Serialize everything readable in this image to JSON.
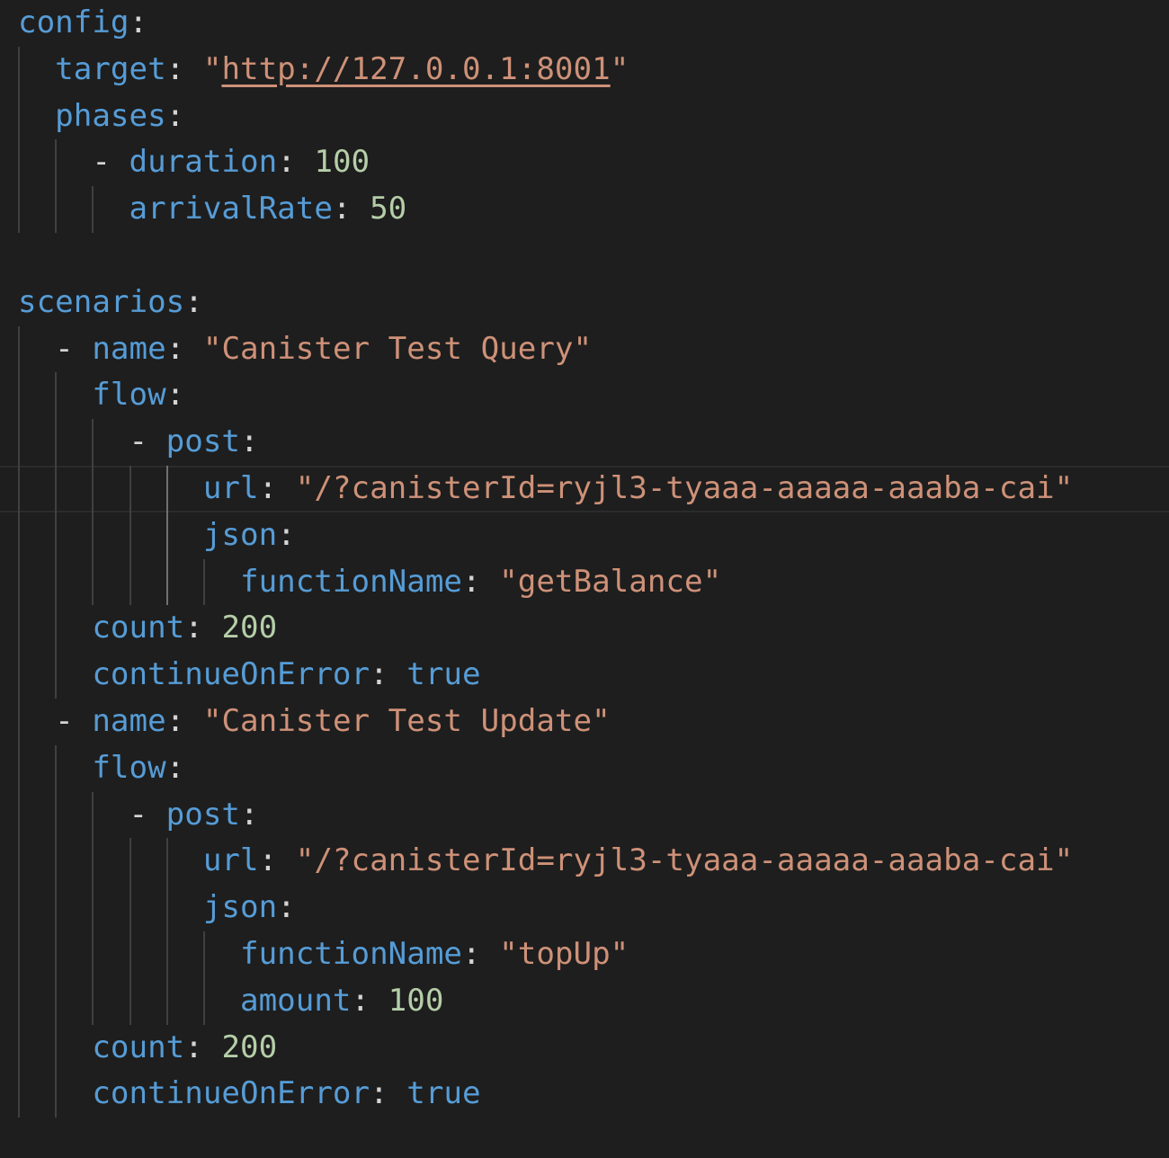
{
  "editor": {
    "language": "yaml",
    "theme_colors": {
      "background": "#1e1e1e",
      "key": "#569cd6",
      "string": "#ce9178",
      "number": "#b5cea8",
      "boolean": "#569cd6",
      "punctuation": "#d4d4d4",
      "indent_guide": "#404040",
      "indent_guide_active": "#707070"
    },
    "current_line": 11,
    "lines": [
      {
        "guides": [],
        "tokens": [
          {
            "t": "key",
            "v": "config"
          },
          {
            "t": "colon",
            "v": ":"
          }
        ]
      },
      {
        "guides": [
          0
        ],
        "tokens": [
          {
            "t": "sp",
            "v": "  "
          },
          {
            "t": "key",
            "v": "target"
          },
          {
            "t": "colon",
            "v": ": "
          },
          {
            "t": "str",
            "v": "\""
          },
          {
            "t": "link",
            "v": "http://127.0.0.1:8001"
          },
          {
            "t": "str",
            "v": "\""
          }
        ]
      },
      {
        "guides": [
          0
        ],
        "tokens": [
          {
            "t": "sp",
            "v": "  "
          },
          {
            "t": "key",
            "v": "phases"
          },
          {
            "t": "colon",
            "v": ":"
          }
        ]
      },
      {
        "guides": [
          0,
          2
        ],
        "tokens": [
          {
            "t": "sp",
            "v": "    "
          },
          {
            "t": "punct",
            "v": "- "
          },
          {
            "t": "key",
            "v": "duration"
          },
          {
            "t": "colon",
            "v": ": "
          },
          {
            "t": "num",
            "v": "100"
          }
        ]
      },
      {
        "guides": [
          0,
          2,
          4
        ],
        "tokens": [
          {
            "t": "sp",
            "v": "      "
          },
          {
            "t": "key",
            "v": "arrivalRate"
          },
          {
            "t": "colon",
            "v": ": "
          },
          {
            "t": "num",
            "v": "50"
          }
        ]
      },
      {
        "guides": [],
        "tokens": []
      },
      {
        "guides": [],
        "tokens": [
          {
            "t": "key",
            "v": "scenarios"
          },
          {
            "t": "colon",
            "v": ":"
          }
        ]
      },
      {
        "guides": [
          0
        ],
        "tokens": [
          {
            "t": "sp",
            "v": "  "
          },
          {
            "t": "punct",
            "v": "- "
          },
          {
            "t": "key",
            "v": "name"
          },
          {
            "t": "colon",
            "v": ": "
          },
          {
            "t": "str",
            "v": "\"Canister Test Query\""
          }
        ]
      },
      {
        "guides": [
          0,
          2
        ],
        "tokens": [
          {
            "t": "sp",
            "v": "    "
          },
          {
            "t": "key",
            "v": "flow"
          },
          {
            "t": "colon",
            "v": ":"
          }
        ]
      },
      {
        "guides": [
          0,
          2,
          4
        ],
        "tokens": [
          {
            "t": "sp",
            "v": "      "
          },
          {
            "t": "punct",
            "v": "- "
          },
          {
            "t": "key",
            "v": "post"
          },
          {
            "t": "colon",
            "v": ":"
          }
        ]
      },
      {
        "guides": [
          0,
          2,
          4,
          6,
          8
        ],
        "active": 8,
        "tokens": [
          {
            "t": "sp",
            "v": "          "
          },
          {
            "t": "key",
            "v": "url"
          },
          {
            "t": "colon",
            "v": ": "
          },
          {
            "t": "str",
            "v": "\"/?canisterId=ryjl3-tyaaa-aaaaa-aaaba-cai\""
          }
        ]
      },
      {
        "guides": [
          0,
          2,
          4,
          6,
          8
        ],
        "active": 8,
        "tokens": [
          {
            "t": "sp",
            "v": "          "
          },
          {
            "t": "key",
            "v": "json"
          },
          {
            "t": "colon",
            "v": ":"
          }
        ]
      },
      {
        "guides": [
          0,
          2,
          4,
          6,
          8,
          10
        ],
        "active": 8,
        "tokens": [
          {
            "t": "sp",
            "v": "            "
          },
          {
            "t": "key",
            "v": "functionName"
          },
          {
            "t": "colon",
            "v": ": "
          },
          {
            "t": "str",
            "v": "\"getBalance\""
          }
        ]
      },
      {
        "guides": [
          0,
          2
        ],
        "tokens": [
          {
            "t": "sp",
            "v": "    "
          },
          {
            "t": "key",
            "v": "count"
          },
          {
            "t": "colon",
            "v": ": "
          },
          {
            "t": "num",
            "v": "200"
          }
        ]
      },
      {
        "guides": [
          0,
          2
        ],
        "tokens": [
          {
            "t": "sp",
            "v": "    "
          },
          {
            "t": "key",
            "v": "continueOnError"
          },
          {
            "t": "colon",
            "v": ": "
          },
          {
            "t": "bool",
            "v": "true"
          }
        ]
      },
      {
        "guides": [
          0
        ],
        "tokens": [
          {
            "t": "sp",
            "v": "  "
          },
          {
            "t": "punct",
            "v": "- "
          },
          {
            "t": "key",
            "v": "name"
          },
          {
            "t": "colon",
            "v": ": "
          },
          {
            "t": "str",
            "v": "\"Canister Test Update\""
          }
        ]
      },
      {
        "guides": [
          0,
          2
        ],
        "tokens": [
          {
            "t": "sp",
            "v": "    "
          },
          {
            "t": "key",
            "v": "flow"
          },
          {
            "t": "colon",
            "v": ":"
          }
        ]
      },
      {
        "guides": [
          0,
          2,
          4
        ],
        "tokens": [
          {
            "t": "sp",
            "v": "      "
          },
          {
            "t": "punct",
            "v": "- "
          },
          {
            "t": "key",
            "v": "post"
          },
          {
            "t": "colon",
            "v": ":"
          }
        ]
      },
      {
        "guides": [
          0,
          2,
          4,
          6,
          8
        ],
        "tokens": [
          {
            "t": "sp",
            "v": "          "
          },
          {
            "t": "key",
            "v": "url"
          },
          {
            "t": "colon",
            "v": ": "
          },
          {
            "t": "str",
            "v": "\"/?canisterId=ryjl3-tyaaa-aaaaa-aaaba-cai\""
          }
        ]
      },
      {
        "guides": [
          0,
          2,
          4,
          6,
          8
        ],
        "tokens": [
          {
            "t": "sp",
            "v": "          "
          },
          {
            "t": "key",
            "v": "json"
          },
          {
            "t": "colon",
            "v": ":"
          }
        ]
      },
      {
        "guides": [
          0,
          2,
          4,
          6,
          8,
          10
        ],
        "tokens": [
          {
            "t": "sp",
            "v": "            "
          },
          {
            "t": "key",
            "v": "functionName"
          },
          {
            "t": "colon",
            "v": ": "
          },
          {
            "t": "str",
            "v": "\"topUp\""
          }
        ]
      },
      {
        "guides": [
          0,
          2,
          4,
          6,
          8,
          10
        ],
        "tokens": [
          {
            "t": "sp",
            "v": "            "
          },
          {
            "t": "key",
            "v": "amount"
          },
          {
            "t": "colon",
            "v": ": "
          },
          {
            "t": "num",
            "v": "100"
          }
        ]
      },
      {
        "guides": [
          0,
          2
        ],
        "tokens": [
          {
            "t": "sp",
            "v": "    "
          },
          {
            "t": "key",
            "v": "count"
          },
          {
            "t": "colon",
            "v": ": "
          },
          {
            "t": "num",
            "v": "200"
          }
        ]
      },
      {
        "guides": [
          0,
          2
        ],
        "tokens": [
          {
            "t": "sp",
            "v": "    "
          },
          {
            "t": "key",
            "v": "continueOnError"
          },
          {
            "t": "colon",
            "v": ": "
          },
          {
            "t": "bool",
            "v": "true"
          }
        ]
      }
    ]
  }
}
